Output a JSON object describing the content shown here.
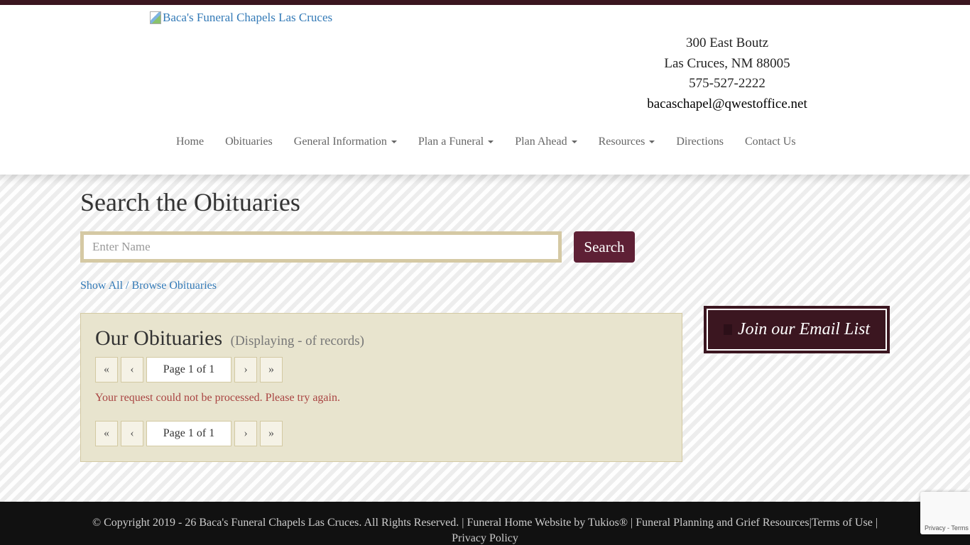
{
  "header": {
    "logo_alt": "Baca's Funeral Chapels Las Cruces",
    "address_line1": "300 East Boutz",
    "address_line2": "Las Cruces, NM 88005",
    "phone": "575-527-2222",
    "email": "bacaschapel@qwestoffice.net"
  },
  "nav": {
    "items": [
      {
        "label": "Home",
        "dropdown": false
      },
      {
        "label": "Obituaries",
        "dropdown": false
      },
      {
        "label": "General Information",
        "dropdown": true
      },
      {
        "label": "Plan a Funeral",
        "dropdown": true
      },
      {
        "label": "Plan Ahead",
        "dropdown": true
      },
      {
        "label": "Resources",
        "dropdown": true
      },
      {
        "label": "Directions",
        "dropdown": false
      },
      {
        "label": "Contact Us",
        "dropdown": false
      }
    ]
  },
  "search": {
    "title": "Search the Obituaries",
    "placeholder": "Enter Name",
    "button_label": "Search",
    "show_all_label": "Show All / Browse Obituaries"
  },
  "obituaries": {
    "title": "Our Obituaries",
    "subtitle": "(Displaying - of records)",
    "pager": {
      "first": "«",
      "prev": "‹",
      "page_info": "Page 1 of 1",
      "next": "›",
      "last": "»"
    },
    "error": "Your request could not be processed. Please try again."
  },
  "sidebar": {
    "email_list_label": "Join our Email List",
    "icon": "envelope-icon"
  },
  "footer": {
    "copyright": "© Copyright 2019 - 26 Baca's Funeral Chapels Las Cruces. All Rights Reserved. |",
    "website_by": "Funeral Home Website by Tukios®",
    "sep1": "|",
    "resources": "Funeral Planning and Grief Resources",
    "sep2": "|",
    "terms": "Terms of Use",
    "sep3": "|",
    "privacy": "Privacy Policy"
  },
  "recaptcha": {
    "privacy": "Privacy",
    "sep": "-",
    "terms": "Terms"
  },
  "colors": {
    "brand_dark": "#3b1620",
    "button": "#5e2035",
    "panel": "#e8e4ce",
    "link": "#337ab7",
    "error": "#a94442"
  }
}
